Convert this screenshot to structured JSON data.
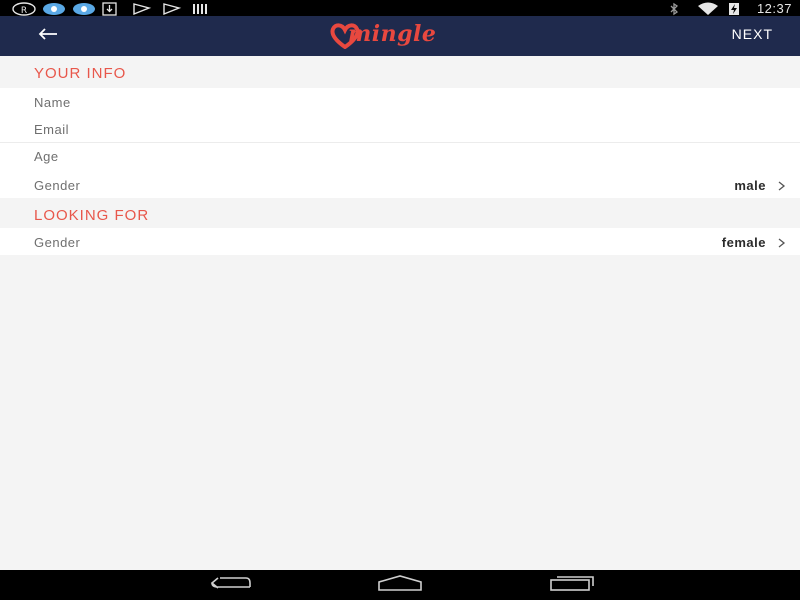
{
  "status_bar": {
    "time": "12:37",
    "left_icons": [
      "registered-icon",
      "app-notification-icon",
      "app-notification-icon",
      "download-icon",
      "play-store-icon",
      "play-store-icon",
      "barcode-icon"
    ],
    "right_icons": [
      "bluetooth-icon",
      "wifi-icon",
      "battery-charging-icon"
    ]
  },
  "app_bar": {
    "logo_text": "mingle",
    "next_label": "NEXT",
    "back_icon": "back-arrow-icon",
    "background": "#1f2a4d",
    "accent": "#e8483f"
  },
  "your_info": {
    "title": "YOUR INFO",
    "fields": {
      "name_label": "Name",
      "email_label": "Email",
      "age_label": "Age",
      "gender_label": "Gender",
      "gender_value": "male"
    }
  },
  "looking_for": {
    "title": "LOOKING FOR",
    "fields": {
      "gender_label": "Gender",
      "gender_value": "female"
    }
  },
  "nav_bar": {
    "buttons": [
      "back-nav-icon",
      "home-nav-icon",
      "recents-nav-icon"
    ]
  }
}
